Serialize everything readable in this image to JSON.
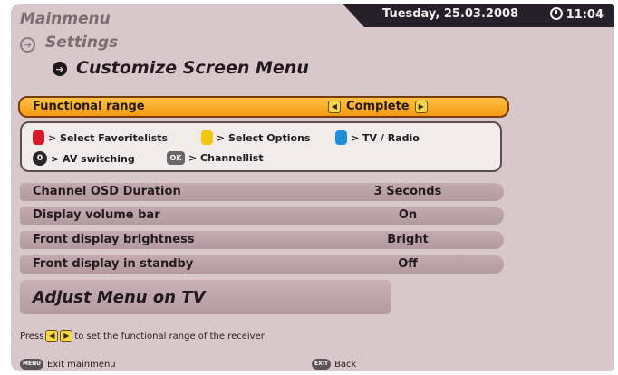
{
  "header": {
    "date": "Tuesday, 25.03.2008",
    "time": "11:04"
  },
  "breadcrumb": {
    "level1": "Mainmenu",
    "level2": "Settings",
    "level3": "Customize Screen Menu"
  },
  "highlighted_setting": {
    "label": "Functional range",
    "value": "Complete"
  },
  "key_legend": {
    "red": "> Select Favoritelists",
    "yellow": "> Select Options",
    "blue": "> TV / Radio",
    "zero_key": "0",
    "zero": "> AV switching",
    "ok_key": "OK",
    "ok": "> Channellist"
  },
  "settings": [
    {
      "label": "Channel OSD Duration",
      "value": "3 Seconds"
    },
    {
      "label": "Display volume bar",
      "value": "On"
    },
    {
      "label": "Front display brightness",
      "value": "Bright"
    },
    {
      "label": "Front display in standby",
      "value": "Off"
    }
  ],
  "adjust_menu_label": "Adjust Menu on TV",
  "hint": {
    "prefix": "Press",
    "suffix": "to set the functional range of the receiver"
  },
  "footer": {
    "menu_key": "MENU",
    "menu_label": "Exit mainmenu",
    "exit_key": "EXIT",
    "exit_label": "Back"
  },
  "colors": {
    "highlight": "#f39a10",
    "background": "#d9c8cb",
    "red_key": "#d8192a",
    "yellow_key": "#f2c70f",
    "blue_key": "#1e8fd8"
  },
  "icons": [
    "clock-icon",
    "arrow-right-circle-icon",
    "left-arrow-key-icon",
    "right-arrow-key-icon"
  ]
}
